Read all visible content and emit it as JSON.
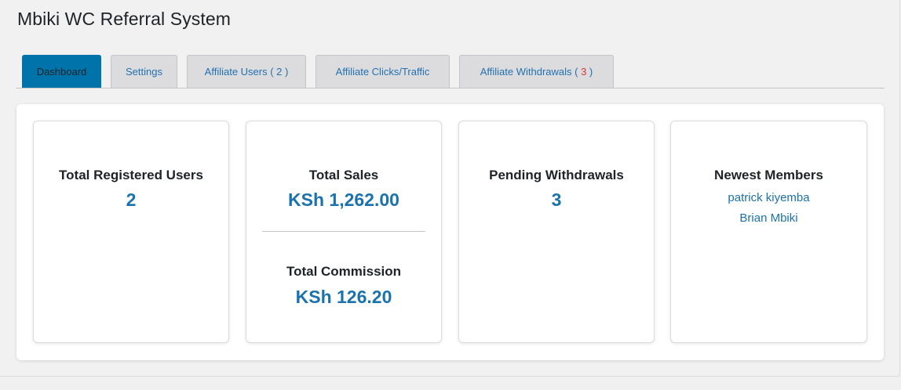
{
  "page_title": "Mbiki WC Referral System",
  "tabs": [
    {
      "label": "Dashboard",
      "active": true
    },
    {
      "label": "Settings"
    },
    {
      "label": "Affiliate Users ( 2 )"
    },
    {
      "label": "Affiliate Clicks/Traffic"
    },
    {
      "label_prefix": "Affiliate Withdrawals ( ",
      "count": "3",
      "label_suffix": " )"
    }
  ],
  "cards": {
    "registered_users": {
      "title": "Total Registered Users",
      "value": "2"
    },
    "sales": {
      "title": "Total Sales",
      "value": "KSh 1,262.00",
      "commission_title": "Total Commission",
      "commission_value": "KSh 126.20"
    },
    "pending_withdrawals": {
      "title": "Pending Withdrawals",
      "value": "3"
    },
    "newest_members": {
      "title": "Newest Members",
      "members": [
        "patrick kiyemba",
        "Brian Mbiki"
      ]
    }
  },
  "colors": {
    "accent": "#0073aa",
    "value_blue": "#1a73ad",
    "link_blue": "#2271b1",
    "alert_red": "#d63638"
  }
}
